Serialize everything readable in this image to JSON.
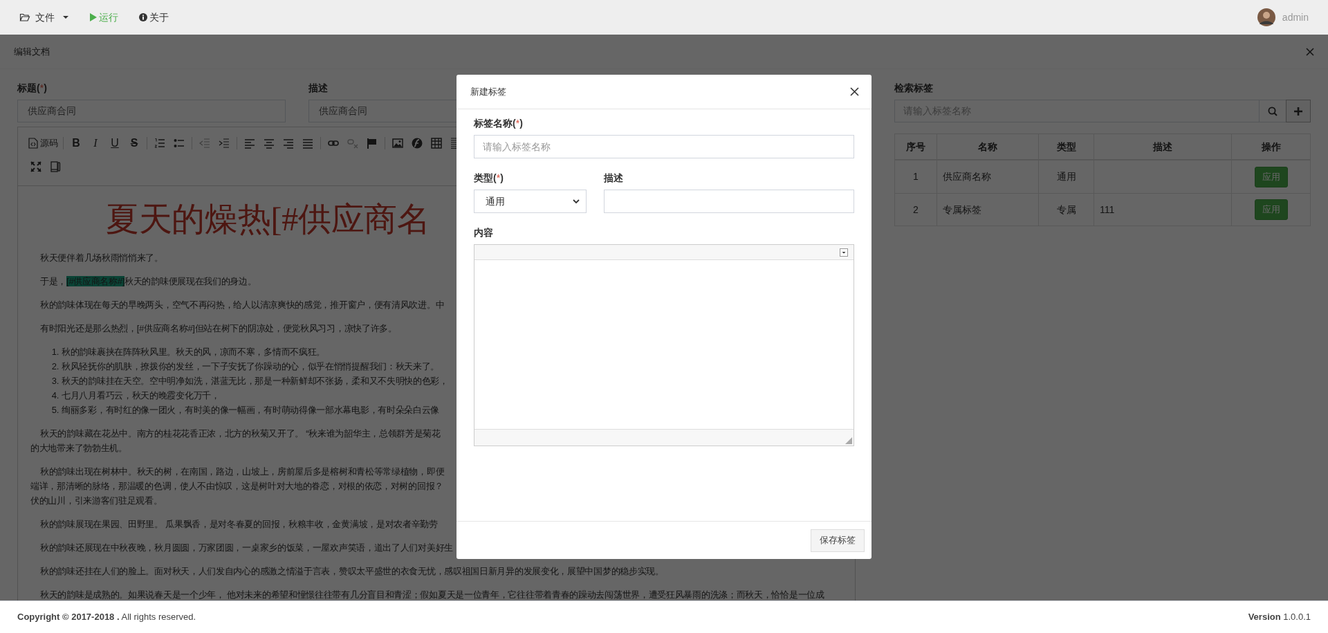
{
  "navbar": {
    "menu": [
      {
        "kind": "file",
        "label": "文件"
      },
      {
        "kind": "run",
        "label": "运行"
      },
      {
        "kind": "about",
        "label": "关于"
      }
    ],
    "user": "admin"
  },
  "panel": {
    "title": "编辑文档"
  },
  "form": {
    "title_label_parts": [
      "标题(",
      "*",
      ")"
    ],
    "title_value": "供应商合同",
    "desc_label": "描述",
    "desc_value": "供应商合同"
  },
  "editor": {
    "toolbar": {
      "source_label": "源码",
      "glyphs": [
        "B",
        "I",
        "U",
        "S"
      ]
    },
    "heading": "夏天的燥热[#供应商名",
    "paragraphs": [
      {
        "kind": "p",
        "lines": [
          "秋天便伴着几场秋雨悄悄来了。"
        ]
      },
      {
        "kind": "tagged",
        "before": "于是，",
        "tag": "[#供应商名称#]",
        "after": "秋天的韵味便展现在我们的身边。"
      },
      {
        "kind": "p",
        "lines": [
          "秋的韵味体现在每天的早晚两头，空气不再闷热，给人以清凉爽快的感觉，推开窗户，便有清风吹进。中"
        ]
      },
      {
        "kind": "p",
        "lines": [
          "有时阳光还是那么热烈，[#供应商名称#]但站在树下的阴凉处，便觉秋风习习，凉快了许多。"
        ]
      },
      {
        "kind": "list",
        "items": [
          {
            "number": "1.",
            "text": "秋的韵味裹挟在阵阵秋风里。秋天的风，凉而不寒，多情而不疯狂。"
          },
          {
            "number": "2.",
            "text": "秋风轻抚你的肌肤，撩拨你的发丝，一下子安抚了你躁动的心，似乎在悄悄提醒我们：秋天来了。"
          },
          {
            "number": "3.",
            "text": "秋天的韵味挂在天空。空中明净如洗，湛蓝无比，那是一种新鲜却不张扬，柔和又不失明快的色彩，"
          },
          {
            "number": "4.",
            "text": "七月八月看巧云，秋天的晚霞变化万千，"
          },
          {
            "number": "5.",
            "text": "绚丽多彩，有时红的像一团火，有时美的像一幅画，有时萌动得像一部水幕电影，有时朵朵白云像"
          }
        ]
      },
      {
        "kind": "p",
        "lines": [
          "秋天的韵味藏在花丛中。南方的桂花花香正浓，北方的秋菊又开了。 “秋来谁为韶华主，总领群芳是菊花",
          "的大地带来了勃勃生机。"
        ]
      },
      {
        "kind": "p",
        "lines": [
          "秋的韵味出现在树林中。秋天的树，在南国，路边，山坡上，房前屋后多是榕树和青松等常绿植物，即便",
          "端详，那清晰的脉络，那温暖的色调，使人不由惊叹，这是树叶对大地的眷恋，对根的依恋，对树的回报？",
          "伏的山川，引来游客们驻足观看。"
        ]
      },
      {
        "kind": "p",
        "lines": [
          "秋的韵味展现在果园、田野里。 瓜果飘香，是对冬春夏的回报，秋粮丰收，金黄满坡，是对农者辛勤劳"
        ]
      },
      {
        "kind": "p",
        "lines": [
          "秋的韵味还展现在中秋夜晚，秋月圆圆，万家团圆，一桌家乡的饭菜，一屋欢声笑语，道出了人们对美好生"
        ]
      },
      {
        "kind": "p",
        "lines": [
          "秋的韵味还挂在人们的脸上。面对秋天，人们发自内心的感激之情溢于言表，赞叹太平盛世的衣食无忧，感叹祖国日新月异的发展变化，展望中国梦的稳步实现。"
        ]
      },
      {
        "kind": "p",
        "lines": [
          "秋天的韵味是成熟的。如果说春天是一个少年， 他对未来的希望和憧憬往往带有几分盲目和青涩；假如夏天是一位青年，它往往带着青春的躁动去闯荡世界，遭受狂风暴雨的洗涤；而秋天，恰恰是一位成"
        ]
      }
    ]
  },
  "tag_search": {
    "label": "检索标签",
    "placeholder": "请输入标签名称"
  },
  "tag_table": {
    "columns": [
      "序号",
      "名称",
      "类型",
      "描述",
      "操作"
    ],
    "rows": [
      {
        "index": "1",
        "name": "供应商名称",
        "type": "通用",
        "action": "应用"
      },
      {
        "index": "2",
        "name": "专属标签",
        "type": "专属",
        "description": "111",
        "action": "应用"
      }
    ]
  },
  "modal": {
    "title": "新建标签",
    "name_label_parts": [
      "标签名称(",
      "*",
      ")"
    ],
    "name_placeholder": "请输入标签名称",
    "type_label_parts": [
      "类型(",
      "*",
      ")"
    ],
    "type_value": "通用",
    "desc_label": "描述",
    "content_label": "内容",
    "save_button": "保存标签"
  },
  "footer": {
    "copyright": "**Copyright © 2017-2018 .** All rights reserved.",
    "version": "**Version** 1.0.0.1"
  }
}
